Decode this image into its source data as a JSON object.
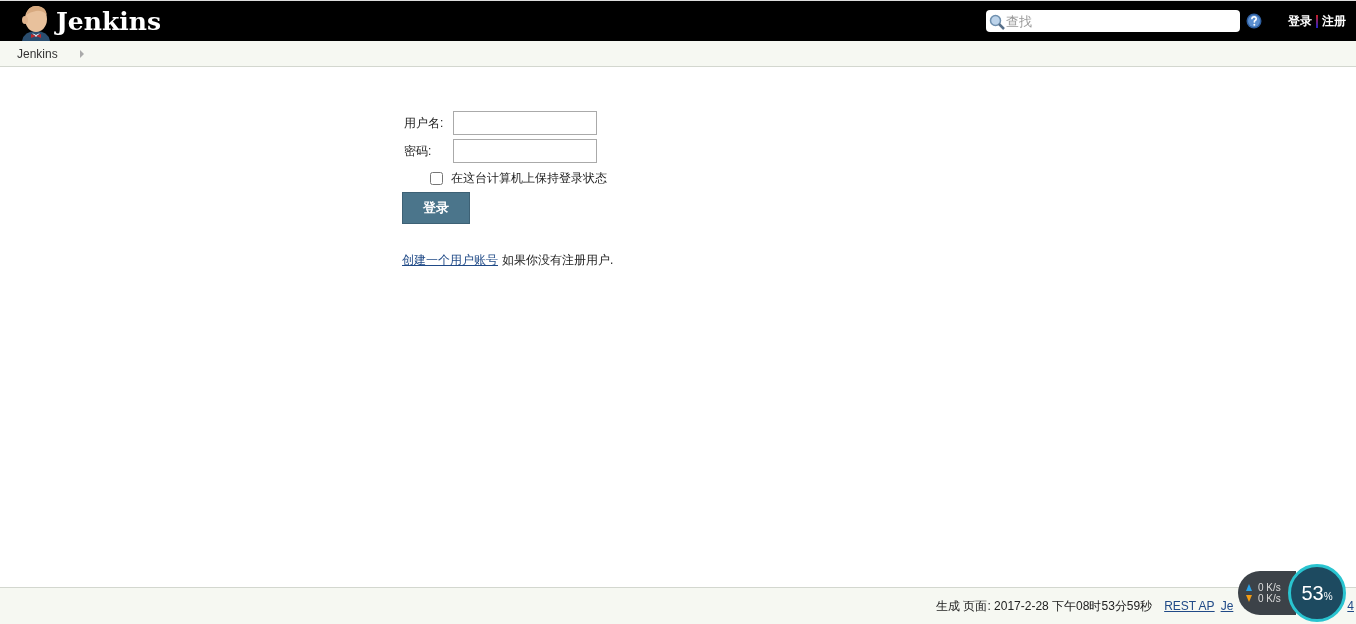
{
  "header": {
    "title": "Jenkins",
    "search": {
      "placeholder": "查找"
    },
    "links": [
      "登录",
      "注册"
    ]
  },
  "breadcrumb": [
    "Jenkins"
  ],
  "login_form": {
    "fields": [
      {
        "label": "用户名:"
      },
      {
        "label": "密码:"
      }
    ],
    "remember": {
      "label": "在这台计算机上保持登录状态",
      "checked": false
    },
    "submit": "登录",
    "signup_link": "创建一个用户账号",
    "signup_text": "如果你没有注册用户."
  },
  "footer": {
    "generated": "生成 页面: 2017-2-28 下午08时53分59秒",
    "links": [
      "REST AP",
      "Je",
      "4"
    ]
  },
  "speed_widget": {
    "upload": "0 K/s",
    "download": "0 K/s",
    "percent": "53",
    "unit": "%"
  }
}
